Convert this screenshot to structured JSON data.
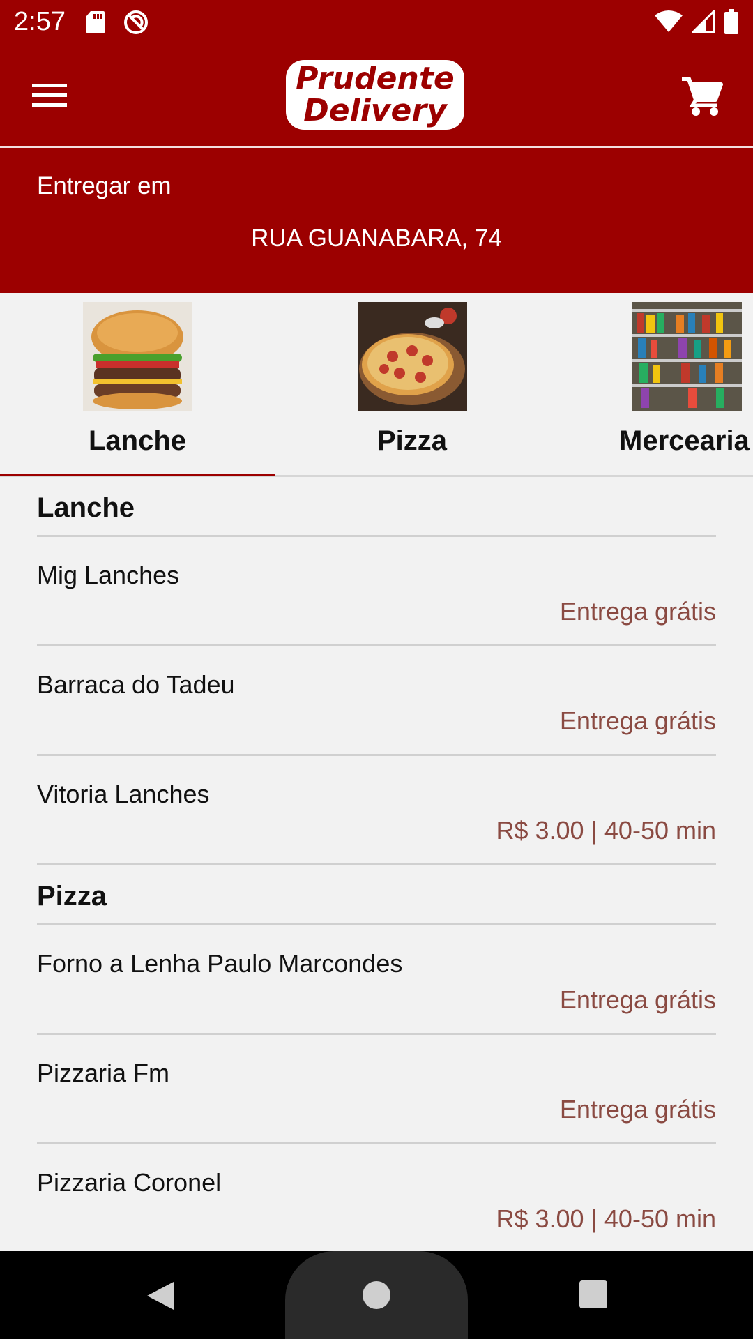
{
  "status_bar": {
    "time": "2:57",
    "icons": [
      "sd-card-icon",
      "do-not-disturb-icon",
      "wifi-icon",
      "signal-icon",
      "battery-icon"
    ]
  },
  "app_bar": {
    "logo_line1": "Prudente",
    "logo_line2": "Delivery",
    "menu_icon": "hamburger-menu-icon",
    "cart_icon": "shopping-cart-icon"
  },
  "delivery": {
    "label": "Entregar em",
    "address": "RUA GUANABARA, 74"
  },
  "categories": [
    {
      "label": "Lanche",
      "image": "burger-photo",
      "active": true
    },
    {
      "label": "Pizza",
      "image": "pizza-photo",
      "active": false
    },
    {
      "label": "Mercearia",
      "image": "grocery-shelves-photo",
      "active": false
    }
  ],
  "sections": [
    {
      "title": "Lanche",
      "items": [
        {
          "name": "Mig Lanches",
          "info": "Entrega grátis"
        },
        {
          "name": "Barraca do Tadeu",
          "info": "Entrega grátis"
        },
        {
          "name": "Vitoria Lanches",
          "info": "R$ 3.00 | 40-50 min"
        }
      ]
    },
    {
      "title": "Pizza",
      "items": [
        {
          "name": "Forno a Lenha Paulo Marcondes",
          "info": "Entrega grátis"
        },
        {
          "name": "Pizzaria Fm",
          "info": "Entrega grátis"
        },
        {
          "name": "Pizzaria Coronel",
          "info": "R$ 3.00 | 40-50 min"
        }
      ]
    }
  ],
  "colors": {
    "brand_red": "#9c0000",
    "info_text": "#8a4a42",
    "background": "#f2f2f2"
  }
}
